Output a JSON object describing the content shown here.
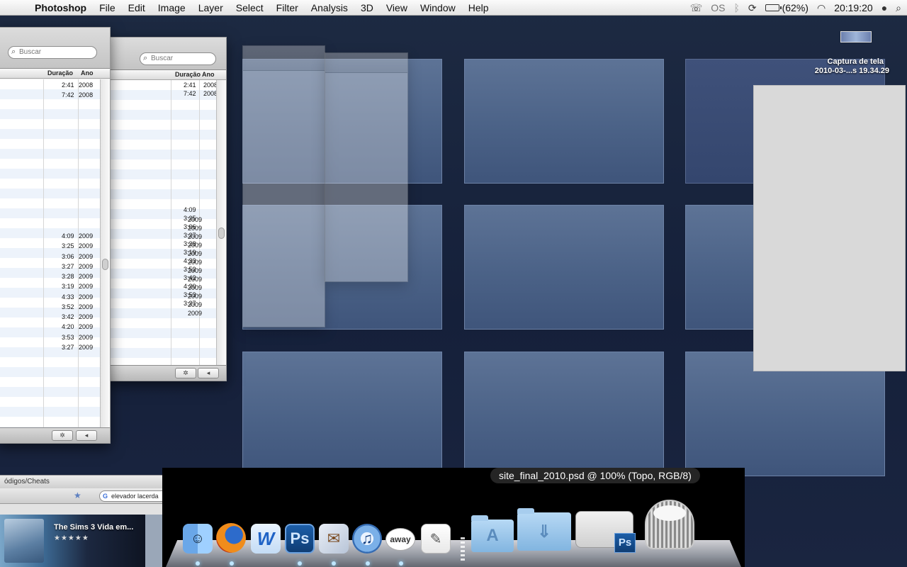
{
  "menubar": {
    "app_name": "Photoshop",
    "menus": [
      "File",
      "Edit",
      "Image",
      "Layer",
      "Select",
      "Filter",
      "Analysis",
      "3D",
      "View",
      "Window",
      "Help"
    ],
    "status": {
      "os_label": "OS",
      "battery": "(62%)",
      "time": "20:19:20"
    },
    "icons": [
      "apple-icon",
      "ichat-icon",
      "os-icon",
      "bluetooth-icon",
      "sync-icon",
      "battery-icon",
      "wifi-icon",
      "user-icon",
      "spotlight-icon"
    ]
  },
  "windows": {
    "front": {
      "search_placeholder": "Buscar",
      "col_duration": "Duração",
      "col_year": "Ano",
      "top_rows": [
        {
          "duration": "2:41",
          "year": "2008"
        },
        {
          "duration": "7:42",
          "year": "2008"
        }
      ],
      "rows": [
        {
          "duration": "4:09",
          "year": "2009"
        },
        {
          "duration": "3:25",
          "year": "2009"
        },
        {
          "duration": "3:06",
          "year": "2009"
        },
        {
          "duration": "3:27",
          "year": "2009"
        },
        {
          "duration": "3:28",
          "year": "2009"
        },
        {
          "duration": "3:19",
          "year": "2009"
        },
        {
          "duration": "4:33",
          "year": "2009"
        },
        {
          "duration": "3:52",
          "year": "2009"
        },
        {
          "duration": "3:42",
          "year": "2009"
        },
        {
          "duration": "4:20",
          "year": "2009"
        },
        {
          "duration": "3:53",
          "year": "2009"
        },
        {
          "duration": "3:27",
          "year": "2009"
        }
      ]
    },
    "second": {
      "search_placeholder": "Buscar",
      "col_duration": "Duração",
      "col_year": "Ano"
    }
  },
  "browser": {
    "tab_label": "ódigos/Cheats",
    "search_value": "elevador lacerda",
    "banner_title": "The Sims 3 Vida em...",
    "banner_stars": "★★★★★"
  },
  "desktop_file": {
    "name_line1": "Captura de tela",
    "name_line2": "2010-03-...s 19.34.29"
  },
  "dock": {
    "tooltip": "site_final_2010.psd @ 100% (Topo, RGB/8)",
    "items": [
      "finder-icon",
      "firefox-icon",
      "word-icon",
      "photoshop-icon",
      "mail-icon",
      "itunes-icon",
      "adium-icon",
      "textedit-icon",
      "applications-folder-icon",
      "downloads-folder-icon",
      "document-stack-icon",
      "trash-icon"
    ],
    "ps_label": "Ps",
    "adium_label": "away"
  },
  "colors": {
    "desktop": "#1b2538",
    "tile": "#5d7396",
    "dock_bg": "#000000",
    "indicator": "#bfe6ff"
  }
}
